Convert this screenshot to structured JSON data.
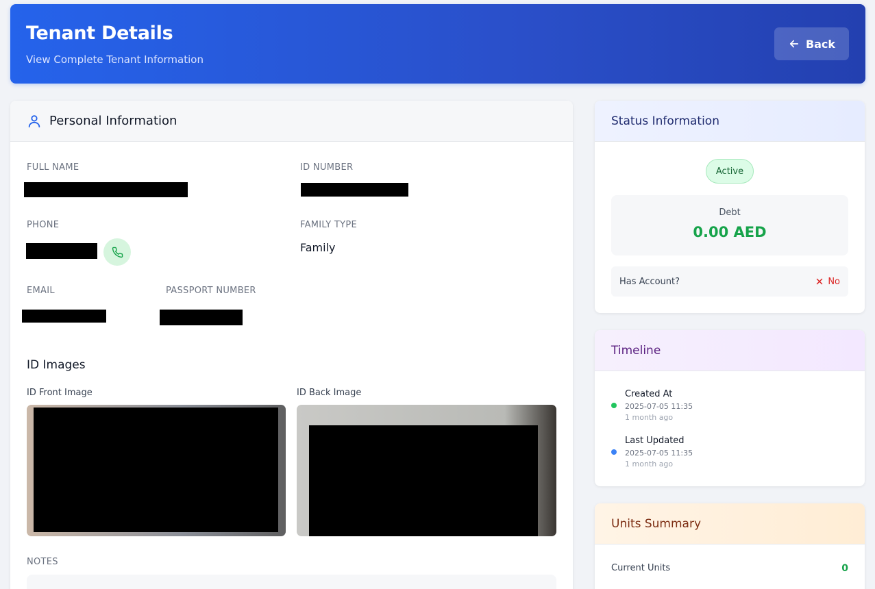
{
  "header": {
    "title": "Tenant Details",
    "subtitle": "View Complete Tenant Information",
    "back_label": "Back"
  },
  "personal": {
    "section_title": "Personal Information",
    "full_name_label": "FULL NAME",
    "id_number_label": "ID NUMBER",
    "phone_label": "PHONE",
    "family_type_label": "FAMILY TYPE",
    "family_type_value": "Family",
    "email_label": "EMAIL",
    "passport_label": "PASSPORT NUMBER",
    "id_images_title": "ID Images",
    "id_front_label": "ID Front Image",
    "id_back_label": "ID Back Image",
    "notes_label": "NOTES"
  },
  "status": {
    "title": "Status Information",
    "badge": "Active",
    "debt_label": "Debt",
    "debt_value": "0.00 AED",
    "account_label": "Has Account?",
    "account_value": "No"
  },
  "timeline": {
    "title": "Timeline",
    "items": [
      {
        "title": "Created At",
        "date": "2025-07-05 11:35",
        "ago": "1 month ago",
        "color": "#22c55e"
      },
      {
        "title": "Last Updated",
        "date": "2025-07-05 11:35",
        "ago": "1 month ago",
        "color": "#3b82f6"
      }
    ]
  },
  "units": {
    "title": "Units Summary",
    "current_label": "Current Units",
    "current_value": "0"
  },
  "colors": {
    "primary": "#2563eb",
    "success": "#16a34a",
    "danger": "#dc2626"
  }
}
